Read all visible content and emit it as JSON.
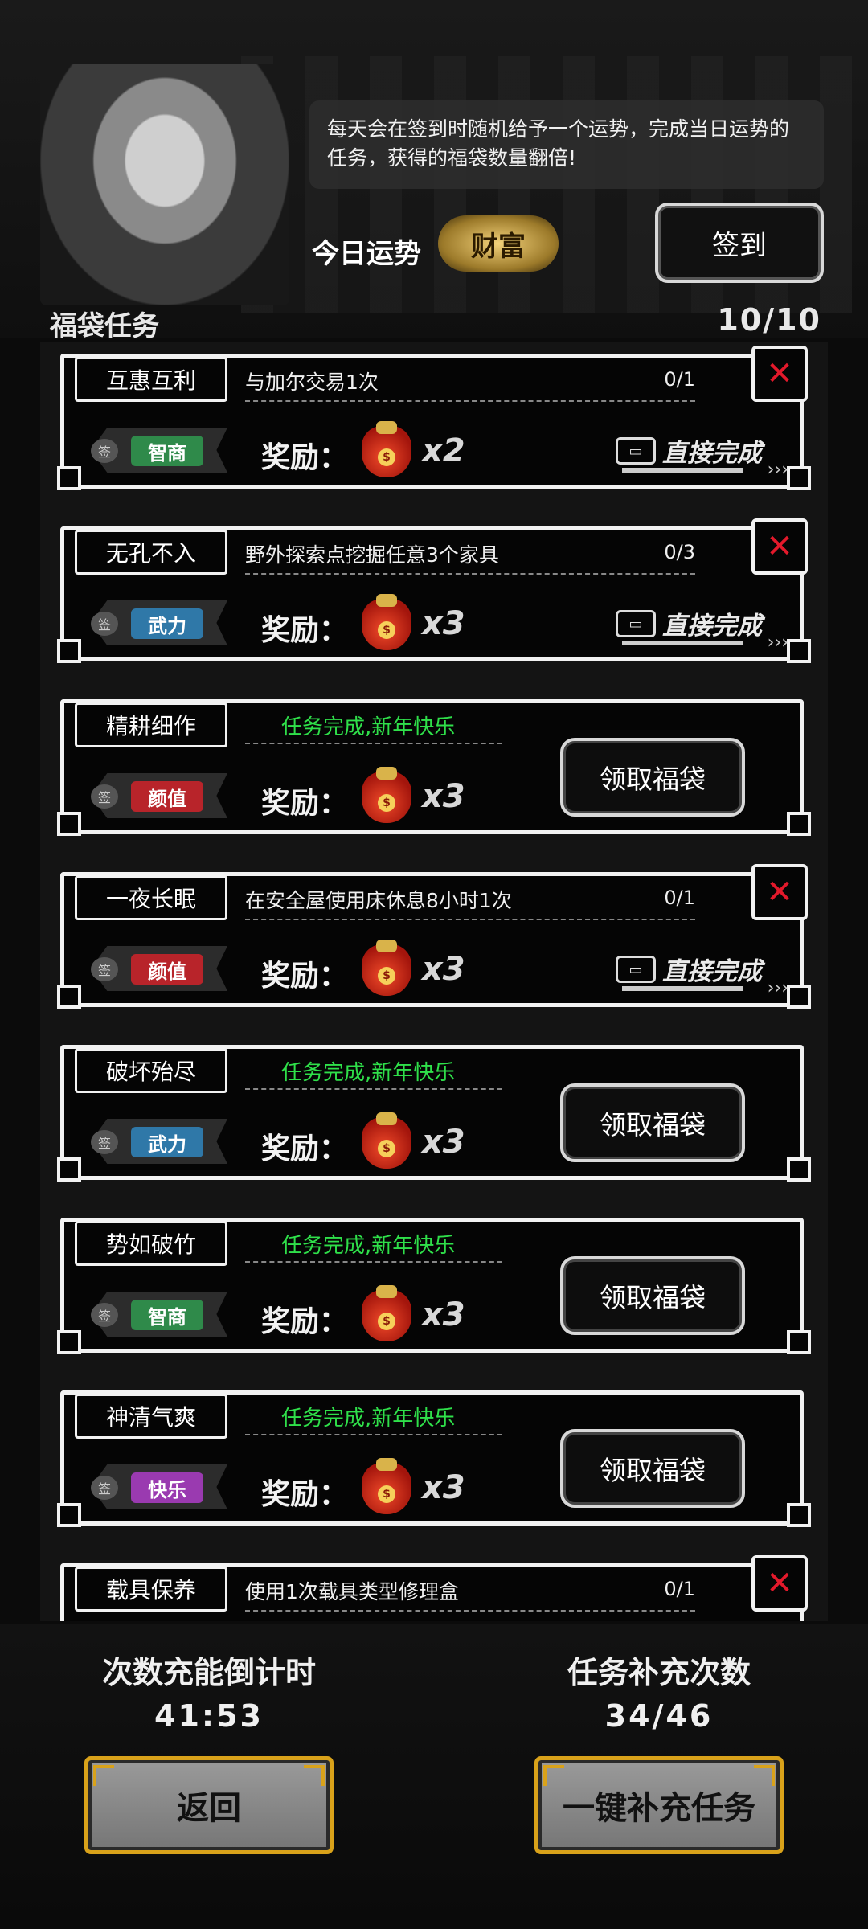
{
  "header": {
    "speech": "每天会在签到时随机给予一个运势，完成当日运势的任务，获得的福袋数量翻倍!",
    "fortune_label": "今日运势",
    "fortune_value": "财富",
    "checkin_label": "签到",
    "section_title": "福袋任务",
    "section_count": "10/10"
  },
  "common": {
    "reward_label": "奖励：",
    "direct_complete": "直接完成",
    "claim_label": "领取福袋",
    "completed_text": "任务完成,新年快乐",
    "seal": "签",
    "close_glyph": "✕",
    "bag_glyph": "$",
    "direct_icon": "▭",
    "direct_arrows": "›››"
  },
  "tasks": [
    {
      "title": "互惠互利",
      "desc": "与加尔交易1次",
      "progress": "0/1",
      "tag": "智商",
      "tag_color": "#2f8a4a",
      "multiplier": "x2",
      "completed": false
    },
    {
      "title": "无孔不入",
      "desc": "野外探索点挖掘任意3个家具",
      "progress": "0/3",
      "tag": "武力",
      "tag_color": "#2f78a8",
      "multiplier": "x3",
      "completed": false
    },
    {
      "title": "精耕细作",
      "desc": "",
      "progress": "",
      "tag": "颜值",
      "tag_color": "#b8242a",
      "multiplier": "x3",
      "completed": true
    },
    {
      "title": "一夜长眠",
      "desc": "在安全屋使用床休息8小时1次",
      "progress": "0/1",
      "tag": "颜值",
      "tag_color": "#b8242a",
      "multiplier": "x3",
      "completed": false
    },
    {
      "title": "破坏殆尽",
      "desc": "",
      "progress": "",
      "tag": "武力",
      "tag_color": "#2f78a8",
      "multiplier": "x3",
      "completed": true
    },
    {
      "title": "势如破竹",
      "desc": "",
      "progress": "",
      "tag": "智商",
      "tag_color": "#2f8a4a",
      "multiplier": "x3",
      "completed": true
    },
    {
      "title": "神清气爽",
      "desc": "",
      "progress": "",
      "tag": "快乐",
      "tag_color": "#9a3ab0",
      "multiplier": "x3",
      "completed": true
    },
    {
      "title": "载具保养",
      "desc": "使用1次载具类型修理盒",
      "progress": "0/1",
      "tag": "",
      "tag_color": "#2c2c2c",
      "multiplier": "",
      "completed": false
    }
  ],
  "footer": {
    "countdown_label": "次数充能倒计时",
    "countdown_value": "41:53",
    "refill_label": "任务补充次数",
    "refill_value": "34/46",
    "back_label": "返回",
    "refill_button_label": "一键补充任务"
  },
  "colors": {
    "accent_gold": "#d9a21a",
    "done_green": "#2fe04a",
    "close_red": "#e3192b"
  }
}
